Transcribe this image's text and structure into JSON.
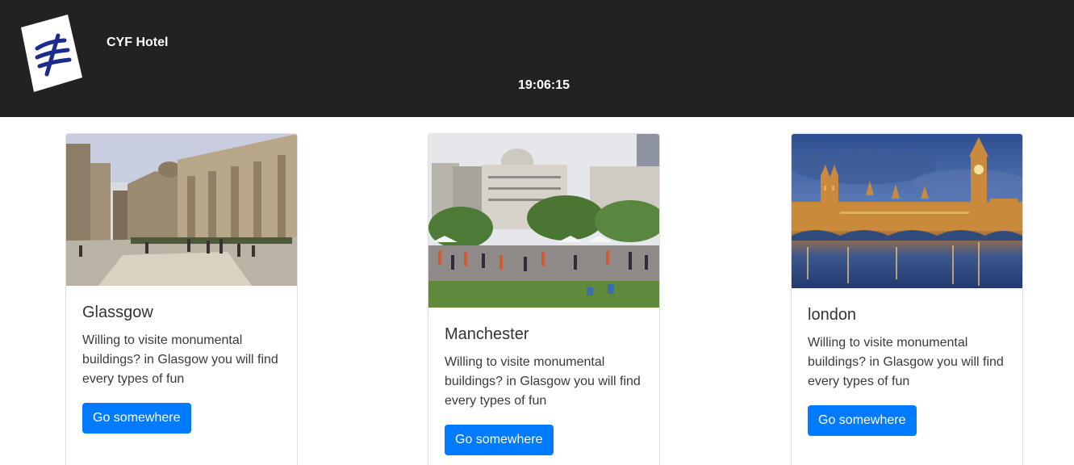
{
  "header": {
    "brand": "CYF Hotel",
    "clock": "19:06:15",
    "background": "#222222"
  },
  "cards": [
    {
      "title": "Glassgow",
      "text": "Willing to visite monumental buildings? in Glasgow you will find every types of fun",
      "button": "Go somewhere",
      "image": "glasgow-street-photo"
    },
    {
      "title": "Manchester",
      "text": "Willing to visite monumental buildings? in Glasgow you will find every types of fun",
      "button": "Go somewhere",
      "image": "manchester-square-photo"
    },
    {
      "title": "london",
      "text": "Willing to visite monumental buildings? in Glasgow you will find every types of fun",
      "button": "Go somewhere",
      "image": "london-westminster-photo"
    }
  ],
  "colors": {
    "accent": "#007bff"
  }
}
